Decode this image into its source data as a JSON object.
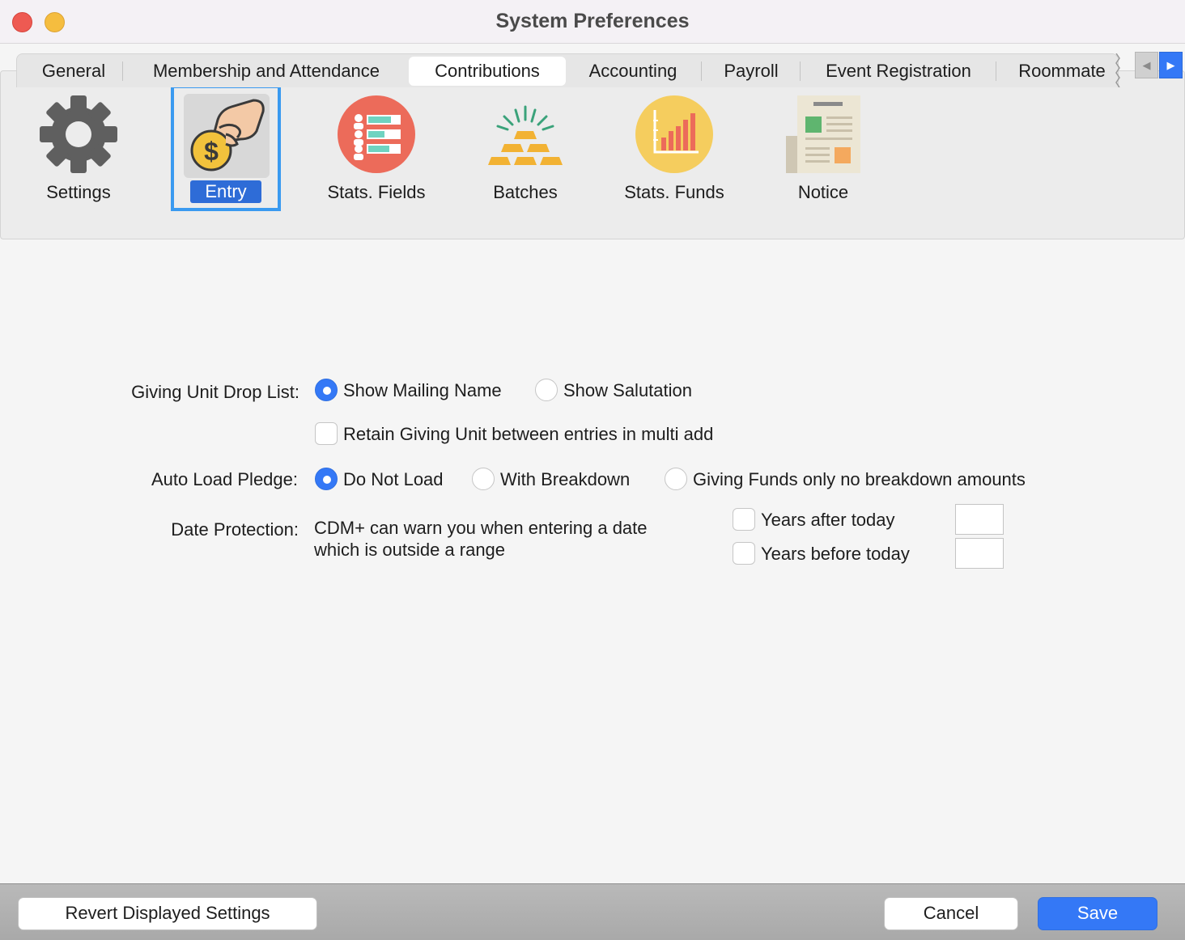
{
  "window": {
    "title": "System Preferences"
  },
  "tabs": [
    {
      "label": "General"
    },
    {
      "label": "Membership and Attendance"
    },
    {
      "label": "Contributions",
      "active": true
    },
    {
      "label": "Accounting"
    },
    {
      "label": "Payroll"
    },
    {
      "label": "Event Registration"
    },
    {
      "label": "Roommate"
    }
  ],
  "toolbar": [
    {
      "label": "Settings",
      "icon": "gear-icon"
    },
    {
      "label": "Entry",
      "icon": "hand-coin-icon",
      "selected": true
    },
    {
      "label": "Stats. Fields",
      "icon": "list-fields-icon"
    },
    {
      "label": "Batches",
      "icon": "gold-bars-icon"
    },
    {
      "label": "Stats. Funds",
      "icon": "bar-chart-icon"
    },
    {
      "label": "Notice",
      "icon": "newspaper-icon"
    }
  ],
  "form": {
    "giving_unit": {
      "label": "Giving Unit Drop List:",
      "options": [
        {
          "label": "Show Mailing Name",
          "selected": true
        },
        {
          "label": "Show Salutation",
          "selected": false
        }
      ],
      "retain_label": "Retain Giving Unit between entries in multi add",
      "retain_checked": false
    },
    "auto_load": {
      "label": "Auto Load Pledge:",
      "options": [
        {
          "label": "Do Not Load",
          "selected": true
        },
        {
          "label": "With Breakdown",
          "selected": false
        },
        {
          "label": "Giving Funds only no breakdown amounts",
          "selected": false
        }
      ]
    },
    "date_protection": {
      "label": "Date Protection:",
      "description_line1": "CDM+ can warn you when entering a date",
      "description_line2": "which is outside a range",
      "after_label": "Years after today",
      "after_value": "",
      "before_label": "Years before today",
      "before_value": ""
    }
  },
  "buttons": {
    "revert": "Revert Displayed Settings",
    "cancel": "Cancel",
    "save": "Save"
  },
  "colors": {
    "accent": "#3478f6",
    "selection_frame": "#3a9af0"
  }
}
